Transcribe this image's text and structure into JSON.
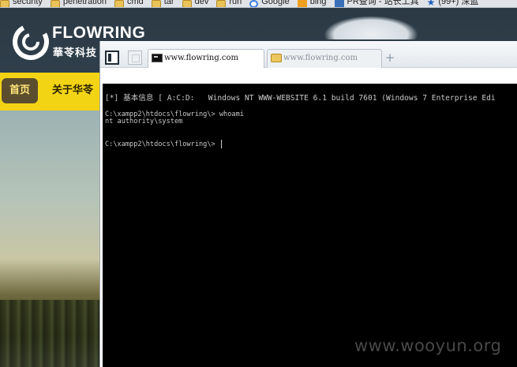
{
  "bookmarks": [
    {
      "label": "security",
      "icon": "folder-icon"
    },
    {
      "label": "penetration",
      "icon": "folder-icon"
    },
    {
      "label": "cmd",
      "icon": "folder-icon"
    },
    {
      "label": "tar",
      "icon": "folder-icon"
    },
    {
      "label": "dev",
      "icon": "folder-icon"
    },
    {
      "label": "run",
      "icon": "folder-icon"
    },
    {
      "label": "Google",
      "icon": "google-icon"
    },
    {
      "label": "bing",
      "icon": "bing-icon"
    },
    {
      "label": "PR查询 - 站长工具",
      "icon": "pr-icon"
    },
    {
      "label": "(99+) 深蓝",
      "icon": "star-icon"
    }
  ],
  "site": {
    "logo_text": "FLOWRING",
    "logo_sub": "華苓科技",
    "nav": {
      "home": "首页",
      "about": "关于华苓"
    }
  },
  "browser": {
    "tabs": [
      {
        "label": "www.flowring.com",
        "icon": "cmd-icon",
        "active": true
      },
      {
        "label": "www.flowring.com",
        "icon": "folder-icon",
        "active": false
      }
    ],
    "new_tab": "+"
  },
  "terminal": {
    "info_line": "[*] 基本信息 [ A:C:D:   Windows NT WWW-WEBSITE 6.1 build 7601 (Windows 7 Enterprise Edi",
    "lines": [
      "C:\\xampp2\\htdocs\\flowring\\> whoami",
      "nt authority\\system",
      "",
      "",
      "C:\\xampp2\\htdocs\\flowring\\> "
    ]
  },
  "watermark": "www.wooyun.org",
  "colors": {
    "nav_yellow": "#f3d414",
    "terminal_bg": "#000000",
    "terminal_fg": "#c8c8c8"
  }
}
